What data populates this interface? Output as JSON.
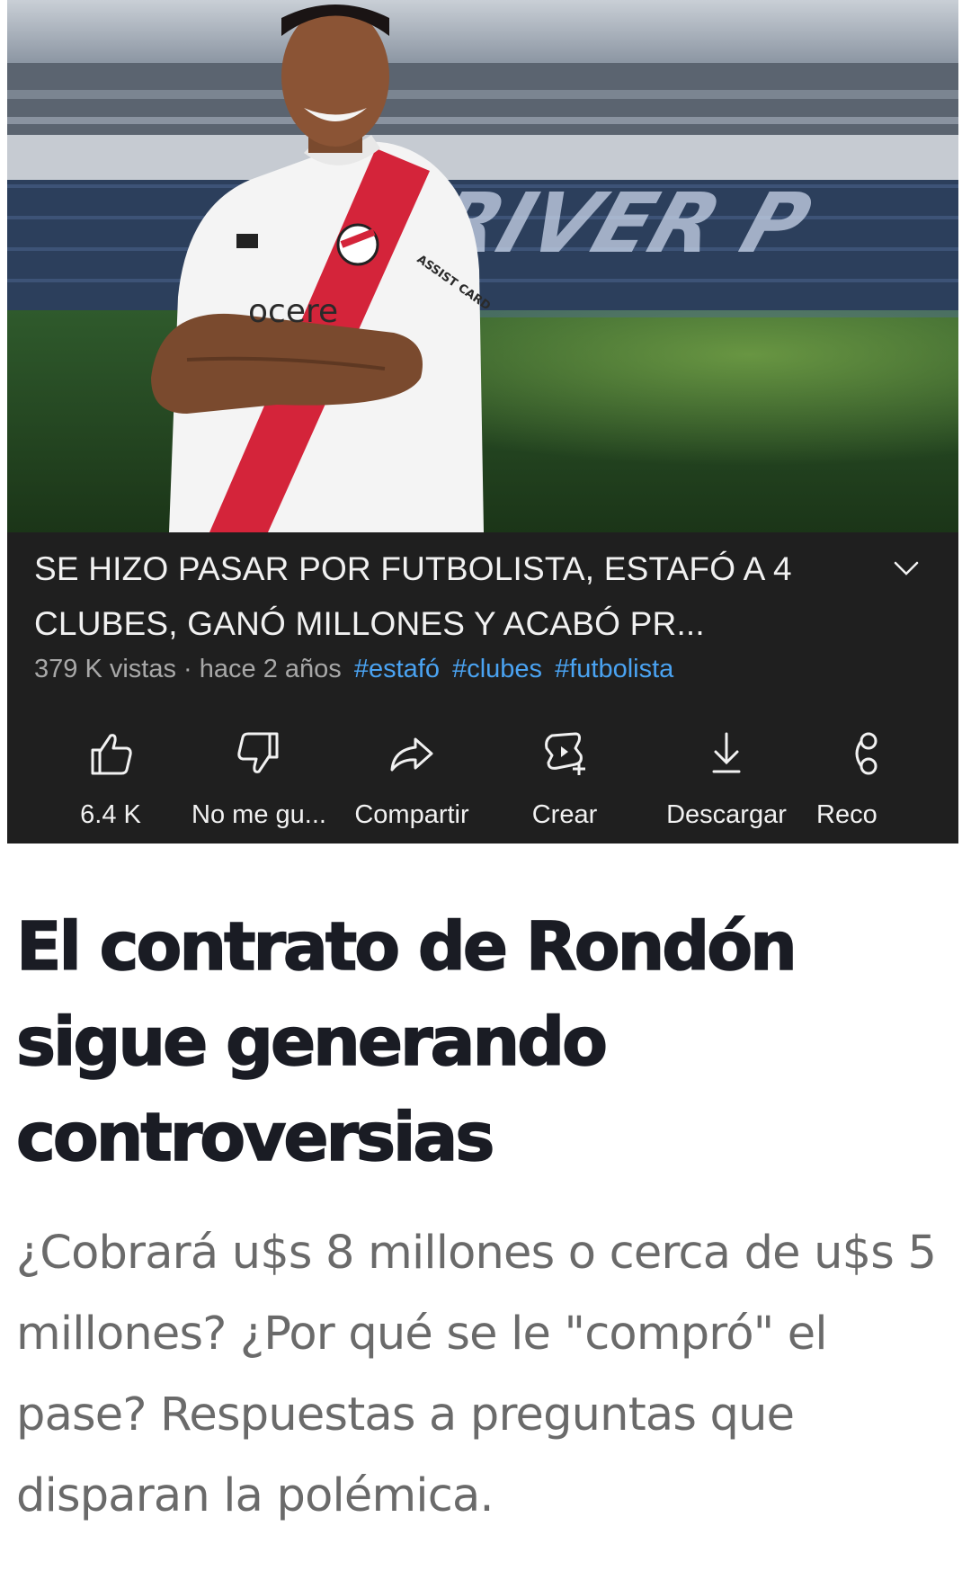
{
  "video": {
    "title": "SE HIZO PASAR POR FUTBOLISTA, ESTAFÓ A 4 CLUBES, GANÓ MILLONES Y ACABÓ PR...",
    "views": "379 K vistas",
    "separator": "·",
    "age": "hace 2 años",
    "hashtags": [
      "#estafó",
      "#clubes",
      "#futbolista"
    ],
    "expand_icon": "chevron-down-icon",
    "actions": [
      {
        "label": "6.4 K",
        "icon": "thumbs-up-icon"
      },
      {
        "label": "No me gu...",
        "icon": "thumbs-down-icon"
      },
      {
        "label": "Compartir",
        "icon": "share-icon"
      },
      {
        "label": "Crear",
        "icon": "create-icon"
      },
      {
        "label": "Descargar",
        "icon": "download-icon"
      },
      {
        "label": "Reco",
        "icon": "remix-icon"
      }
    ],
    "thumbnail": {
      "jersey_sponsor": "ocere",
      "sleeve_text": "ASSIST CARD",
      "stadium_text": "RIVER P"
    }
  },
  "article": {
    "title": "El contrato de Rondón sigue generando controversias",
    "subtitle": "¿Cobrará u$s 8 millones o cerca de u$s 5 millones? ¿Por qué se le \"compró\" el pase? Respuestas a preguntas que disparan la polémica."
  },
  "colors": {
    "card_bg": "#1f1f1f",
    "hashtag": "#4aa3f2",
    "meta": "#a8a8a8",
    "article_title": "#1a1c24",
    "article_subtitle": "#6a6a6a"
  }
}
